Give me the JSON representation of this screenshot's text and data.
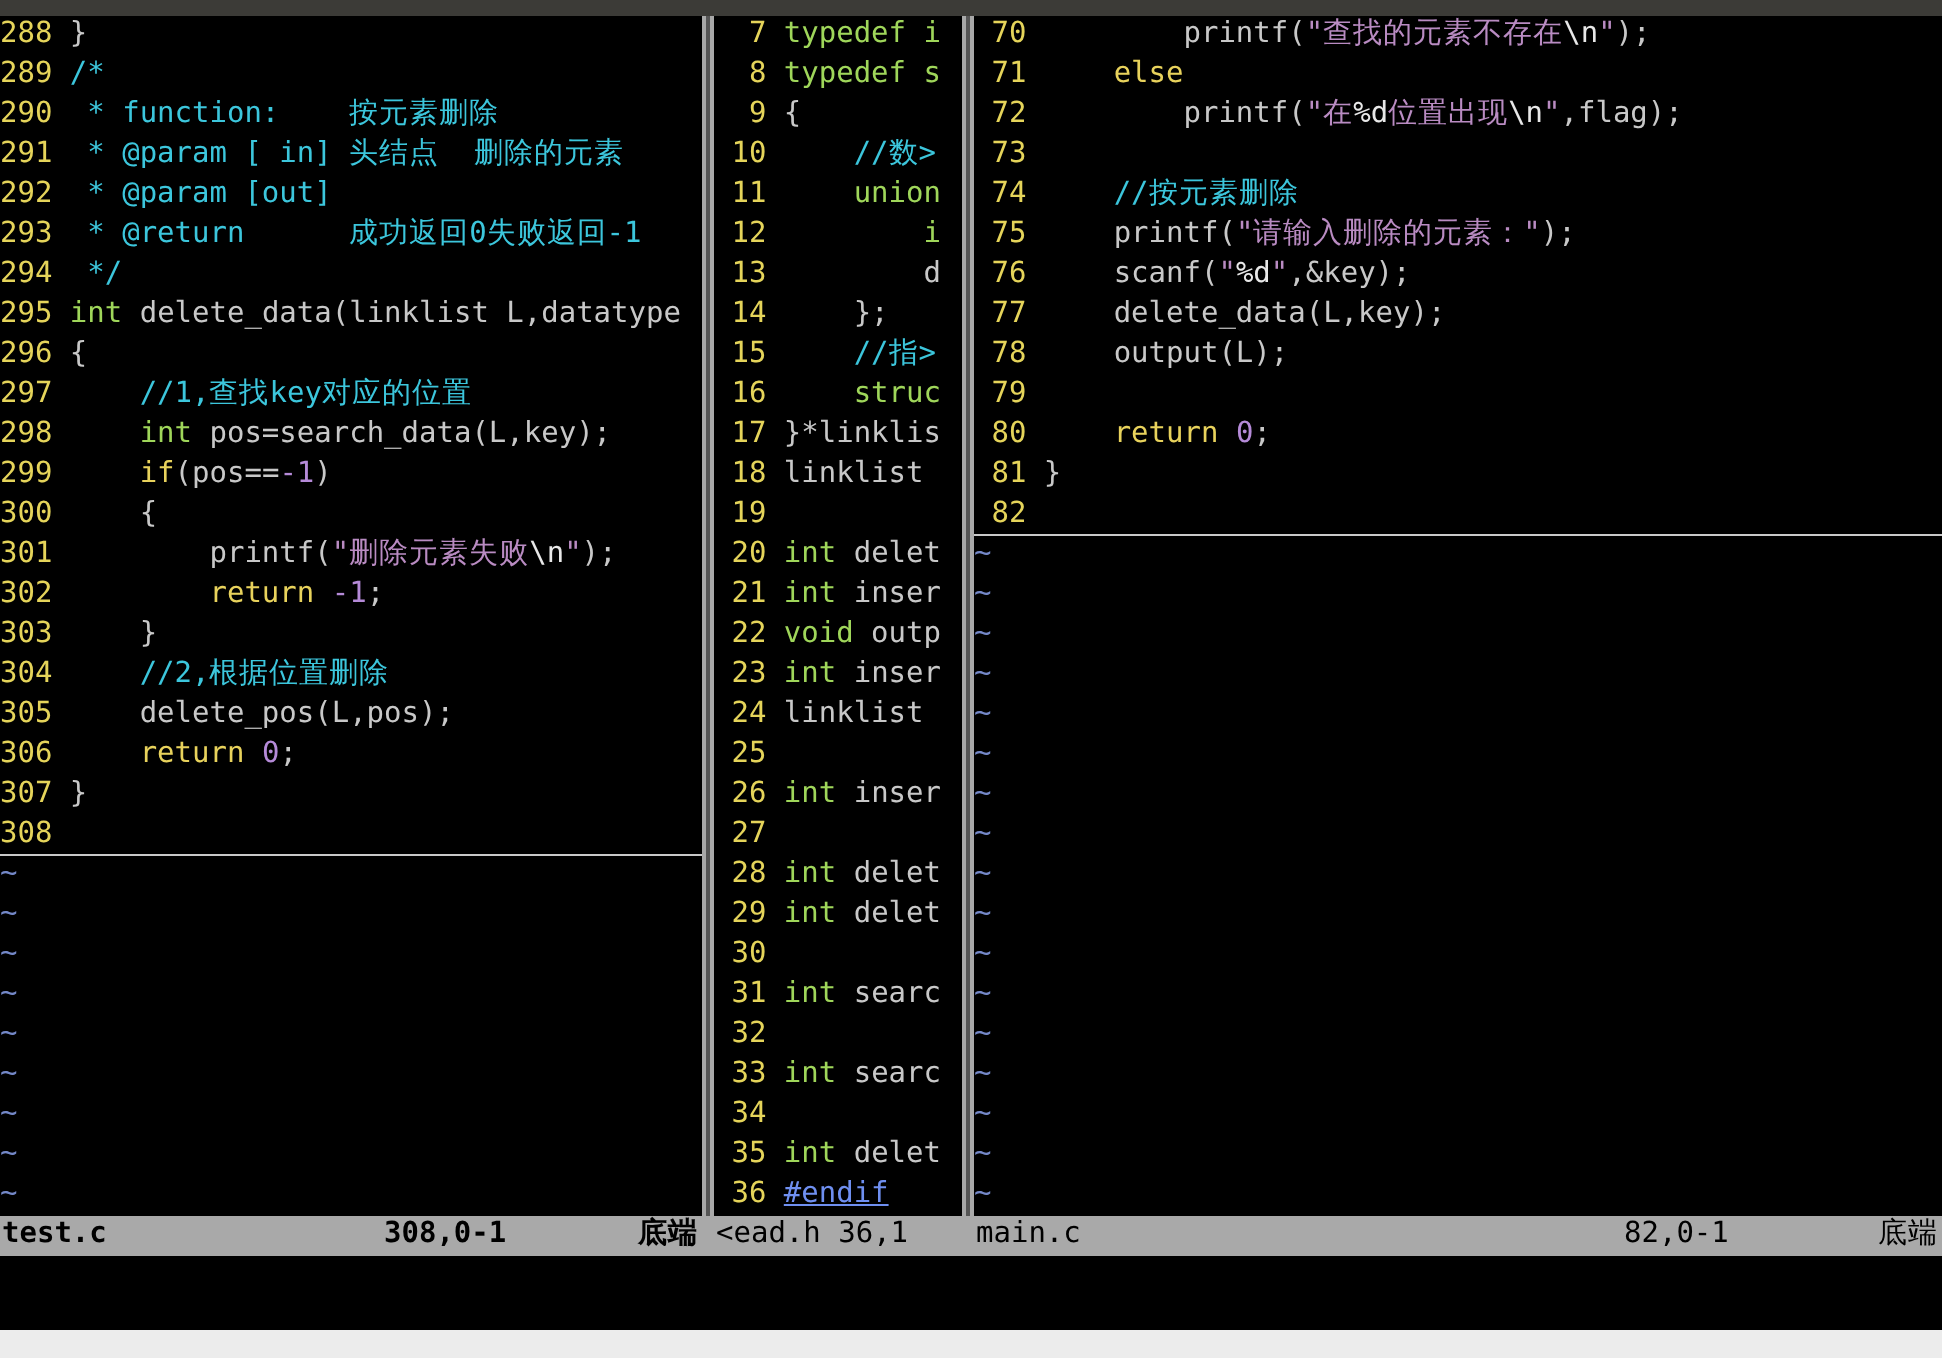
{
  "panes": [
    {
      "lines": [
        {
          "number": "288",
          "cursor": false,
          "segments": [
            {
              "kind": "plain",
              "text": "}"
            }
          ]
        },
        {
          "number": "289",
          "cursor": false,
          "segments": [
            {
              "kind": "comment",
              "text": "/*"
            }
          ]
        },
        {
          "number": "290",
          "cursor": false,
          "segments": [
            {
              "kind": "comment",
              "text": " * function:    按元素删除"
            }
          ]
        },
        {
          "number": "291",
          "cursor": false,
          "segments": [
            {
              "kind": "comment",
              "text": " * @param [ in] 头结点  删除的元素"
            }
          ]
        },
        {
          "number": "292",
          "cursor": false,
          "segments": [
            {
              "kind": "comment",
              "text": " * @param [out]"
            }
          ]
        },
        {
          "number": "293",
          "cursor": false,
          "segments": [
            {
              "kind": "comment",
              "text": " * @return      成功返回0失败返回-1"
            }
          ]
        },
        {
          "number": "294",
          "cursor": false,
          "segments": [
            {
              "kind": "comment",
              "text": " */"
            }
          ]
        },
        {
          "number": "295",
          "cursor": false,
          "segments": [
            {
              "kind": "type",
              "text": "int"
            },
            {
              "kind": "plain",
              "text": " delete_data(linklist L,datatype"
            }
          ]
        },
        {
          "number": "296",
          "cursor": false,
          "segments": [
            {
              "kind": "plain",
              "text": "{"
            }
          ]
        },
        {
          "number": "297",
          "cursor": false,
          "segments": [
            {
              "kind": "comment",
              "text": "    //1,查找key对应的位置"
            }
          ]
        },
        {
          "number": "298",
          "cursor": false,
          "segments": [
            {
              "kind": "type",
              "text": "    int"
            },
            {
              "kind": "plain",
              "text": " pos=search_data(L,key);"
            }
          ]
        },
        {
          "number": "299",
          "cursor": false,
          "segments": [
            {
              "kind": "keyword",
              "text": "    if"
            },
            {
              "kind": "plain",
              "text": "(pos=="
            },
            {
              "kind": "number",
              "text": "-1"
            },
            {
              "kind": "plain",
              "text": ")"
            }
          ]
        },
        {
          "number": "300",
          "cursor": false,
          "segments": [
            {
              "kind": "plain",
              "text": "    {"
            }
          ]
        },
        {
          "number": "301",
          "cursor": false,
          "segments": [
            {
              "kind": "plain",
              "text": "        printf("
            },
            {
              "kind": "string",
              "text": "\"删除元素失败"
            },
            {
              "kind": "special",
              "text": "\\n"
            },
            {
              "kind": "string",
              "text": "\""
            },
            {
              "kind": "plain",
              "text": ");"
            }
          ]
        },
        {
          "number": "302",
          "cursor": false,
          "segments": [
            {
              "kind": "keyword",
              "text": "        return"
            },
            {
              "kind": "number",
              "text": " -1"
            },
            {
              "kind": "plain",
              "text": ";"
            }
          ]
        },
        {
          "number": "303",
          "cursor": false,
          "segments": [
            {
              "kind": "plain",
              "text": "    }"
            }
          ]
        },
        {
          "number": "304",
          "cursor": false,
          "segments": [
            {
              "kind": "comment",
              "text": "    //2,根据位置删除"
            }
          ]
        },
        {
          "number": "305",
          "cursor": false,
          "segments": [
            {
              "kind": "plain",
              "text": "    delete_pos(L,pos);"
            }
          ]
        },
        {
          "number": "306",
          "cursor": false,
          "segments": [
            {
              "kind": "keyword",
              "text": "    return"
            },
            {
              "kind": "number",
              "text": " 0"
            },
            {
              "kind": "plain",
              "text": ";"
            }
          ]
        },
        {
          "number": "307",
          "cursor": false,
          "segments": [
            {
              "kind": "plain",
              "text": "}"
            }
          ]
        },
        {
          "number": "308",
          "cursor": true
        }
      ],
      "filler": [
        "~",
        "~",
        "~",
        "~",
        "~",
        "~",
        "~",
        "~",
        "~"
      ],
      "status": {
        "active": true,
        "file": "test.c",
        "position": "308,0-1",
        "scroll": "底端"
      }
    },
    {
      "lines": [
        {
          "number": "7",
          "cursor": false,
          "segments": [
            {
              "kind": "type",
              "text": "typedef i"
            }
          ]
        },
        {
          "number": "8",
          "cursor": false,
          "segments": [
            {
              "kind": "type",
              "text": "typedef s"
            }
          ]
        },
        {
          "number": "9",
          "cursor": false,
          "segments": [
            {
              "kind": "plain",
              "text": "{"
            }
          ]
        },
        {
          "number": "10",
          "cursor": false,
          "segments": [
            {
              "kind": "comment",
              "text": "    //数>"
            }
          ]
        },
        {
          "number": "11",
          "cursor": false,
          "segments": [
            {
              "kind": "type",
              "text": "    union"
            }
          ]
        },
        {
          "number": "12",
          "cursor": false,
          "segments": [
            {
              "kind": "type",
              "text": "        i"
            }
          ]
        },
        {
          "number": "13",
          "cursor": false,
          "segments": [
            {
              "kind": "plain",
              "text": "        d"
            }
          ]
        },
        {
          "number": "14",
          "cursor": false,
          "segments": [
            {
              "kind": "plain",
              "text": "    };"
            }
          ]
        },
        {
          "number": "15",
          "cursor": false,
          "segments": [
            {
              "kind": "comment",
              "text": "    //指>"
            }
          ]
        },
        {
          "number": "16",
          "cursor": false,
          "segments": [
            {
              "kind": "type",
              "text": "    struc"
            }
          ]
        },
        {
          "number": "17",
          "cursor": false,
          "segments": [
            {
              "kind": "plain",
              "text": "}*linklis"
            }
          ]
        },
        {
          "number": "18",
          "cursor": false,
          "segments": [
            {
              "kind": "plain",
              "text": "linklist"
            }
          ]
        },
        {
          "number": "19",
          "cursor": false
        },
        {
          "number": "20",
          "cursor": false,
          "segments": [
            {
              "kind": "type",
              "text": "int"
            },
            {
              "kind": "plain",
              "text": " delet"
            }
          ]
        },
        {
          "number": "21",
          "cursor": false,
          "segments": [
            {
              "kind": "type",
              "text": "int"
            },
            {
              "kind": "plain",
              "text": " inser"
            }
          ]
        },
        {
          "number": "22",
          "cursor": false,
          "segments": [
            {
              "kind": "type",
              "text": "void"
            },
            {
              "kind": "plain",
              "text": " outp"
            }
          ]
        },
        {
          "number": "23",
          "cursor": false,
          "segments": [
            {
              "kind": "type",
              "text": "int"
            },
            {
              "kind": "plain",
              "text": " inser"
            }
          ]
        },
        {
          "number": "24",
          "cursor": false,
          "segments": [
            {
              "kind": "plain",
              "text": "linklist"
            }
          ]
        },
        {
          "number": "25",
          "cursor": false
        },
        {
          "number": "26",
          "cursor": false,
          "segments": [
            {
              "kind": "type",
              "text": "int"
            },
            {
              "kind": "plain",
              "text": " inser"
            }
          ]
        },
        {
          "number": "27",
          "cursor": false
        },
        {
          "number": "28",
          "cursor": false,
          "segments": [
            {
              "kind": "type",
              "text": "int"
            },
            {
              "kind": "plain",
              "text": " delet"
            }
          ]
        },
        {
          "number": "29",
          "cursor": false,
          "segments": [
            {
              "kind": "type",
              "text": "int"
            },
            {
              "kind": "plain",
              "text": " delet"
            }
          ]
        },
        {
          "number": "30",
          "cursor": false
        },
        {
          "number": "31",
          "cursor": false,
          "segments": [
            {
              "kind": "type",
              "text": "int"
            },
            {
              "kind": "plain",
              "text": " searc"
            }
          ]
        },
        {
          "number": "32",
          "cursor": false
        },
        {
          "number": "33",
          "cursor": false,
          "segments": [
            {
              "kind": "type",
              "text": "int"
            },
            {
              "kind": "plain",
              "text": " searc"
            }
          ]
        },
        {
          "number": "34",
          "cursor": false
        },
        {
          "number": "35",
          "cursor": false,
          "segments": [
            {
              "kind": "type",
              "text": "int"
            },
            {
              "kind": "plain",
              "text": " delet"
            }
          ]
        },
        {
          "number": "36",
          "cursor": false,
          "segments": [
            {
              "kind": "preproc",
              "text": "#endif"
            }
          ]
        }
      ],
      "status": {
        "active": false,
        "file": "<ead.h 36,1"
      }
    },
    {
      "lines": [
        {
          "number": "70",
          "cursor": false,
          "segments": [
            {
              "kind": "plain",
              "text": "        printf("
            },
            {
              "kind": "string",
              "text": "\"查找的元素不存在"
            },
            {
              "kind": "special",
              "text": "\\n"
            },
            {
              "kind": "string",
              "text": "\""
            },
            {
              "kind": "plain",
              "text": ");"
            }
          ]
        },
        {
          "number": "71",
          "cursor": false,
          "segments": [
            {
              "kind": "keyword",
              "text": "    else"
            }
          ]
        },
        {
          "number": "72",
          "cursor": false,
          "segments": [
            {
              "kind": "plain",
              "text": "        printf("
            },
            {
              "kind": "string",
              "text": "\"在"
            },
            {
              "kind": "special",
              "text": "%d"
            },
            {
              "kind": "string",
              "text": "位置出现"
            },
            {
              "kind": "special",
              "text": "\\n"
            },
            {
              "kind": "string",
              "text": "\""
            },
            {
              "kind": "plain",
              "text": ",flag);"
            }
          ]
        },
        {
          "number": "73",
          "cursor": false
        },
        {
          "number": "74",
          "cursor": false,
          "segments": [
            {
              "kind": "comment",
              "text": "    //按元素删除"
            }
          ]
        },
        {
          "number": "75",
          "cursor": false,
          "segments": [
            {
              "kind": "plain",
              "text": "    printf("
            },
            {
              "kind": "string",
              "text": "\"请输入删除的元素：\""
            },
            {
              "kind": "plain",
              "text": ");"
            }
          ]
        },
        {
          "number": "76",
          "cursor": false,
          "segments": [
            {
              "kind": "plain",
              "text": "    scanf("
            },
            {
              "kind": "string",
              "text": "\""
            },
            {
              "kind": "special",
              "text": "%d"
            },
            {
              "kind": "string",
              "text": "\""
            },
            {
              "kind": "plain",
              "text": ",&key);"
            }
          ]
        },
        {
          "number": "77",
          "cursor": false,
          "segments": [
            {
              "kind": "plain",
              "text": "    delete_data(L,key);"
            }
          ]
        },
        {
          "number": "78",
          "cursor": false,
          "segments": [
            {
              "kind": "plain",
              "text": "    output(L);"
            }
          ]
        },
        {
          "number": "79",
          "cursor": false
        },
        {
          "number": "80",
          "cursor": false,
          "segments": [
            {
              "kind": "keyword",
              "text": "    return"
            },
            {
              "kind": "number",
              "text": " 0"
            },
            {
              "kind": "plain",
              "text": ";"
            }
          ]
        },
        {
          "number": "81",
          "cursor": false,
          "segments": [
            {
              "kind": "plain",
              "text": "}"
            }
          ]
        },
        {
          "number": "82",
          "cursor": true
        }
      ],
      "filler": [
        "~",
        "~",
        "~",
        "~",
        "~",
        "~",
        "~",
        "~",
        "~",
        "~",
        "~",
        "~",
        "~",
        "~",
        "~",
        "~",
        "~"
      ],
      "status": {
        "active": false,
        "file": "main.c",
        "position": "82,0-1",
        "scroll": "底端"
      }
    }
  ]
}
